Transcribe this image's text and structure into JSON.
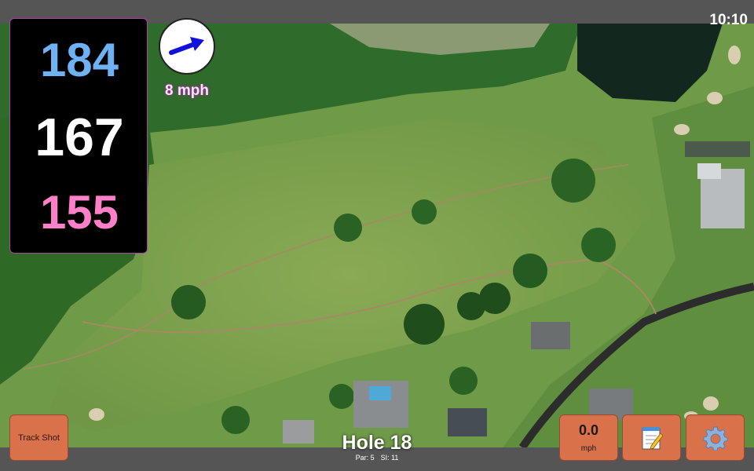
{
  "status": {
    "time": "10:10"
  },
  "distances": {
    "back": "184",
    "middle": "167",
    "front": "155"
  },
  "wind": {
    "speed_label": "8 mph",
    "direction": "east-northeast"
  },
  "hole": {
    "title": "Hole 18",
    "par": "Par: 5",
    "stroke_index": "SI: 11"
  },
  "buttons": {
    "track_shot": "Track Shot",
    "speed_value": "0.0",
    "speed_unit": "mph",
    "notes_icon": "notepad-icon",
    "settings_icon": "gear-icon"
  },
  "colors": {
    "back_distance": "#6fb2f4",
    "middle_distance": "#ffffff",
    "front_distance": "#ff80c8",
    "button": "#d9714a",
    "bar": "#555555"
  }
}
